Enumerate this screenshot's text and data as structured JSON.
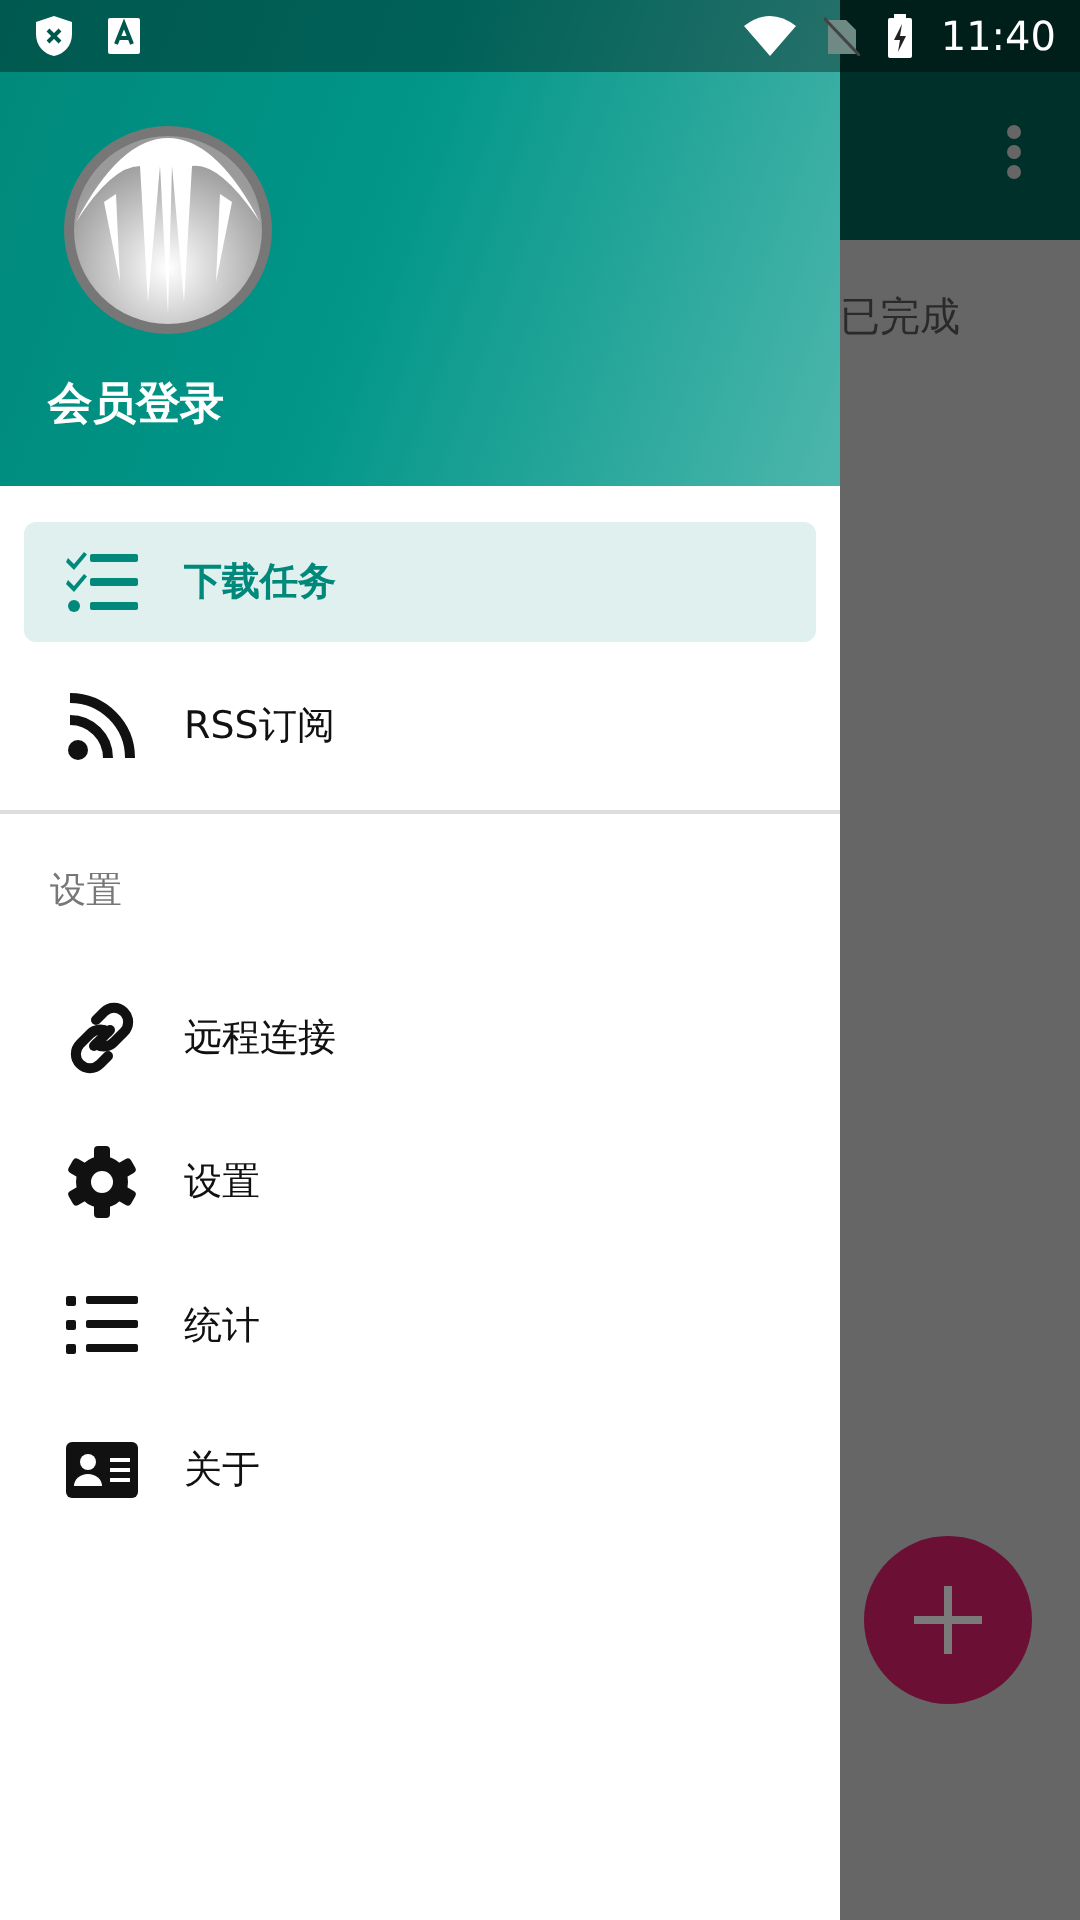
{
  "status_bar": {
    "time": "11:40"
  },
  "background_screen": {
    "tab_label": "已完成"
  },
  "drawer": {
    "header": {
      "title": "会员登录"
    },
    "items": [
      {
        "label": "下载任务",
        "selected": true
      },
      {
        "label": "RSS订阅",
        "selected": false
      }
    ],
    "section": {
      "title": "设置",
      "items": [
        {
          "label": "远程连接",
          "selected": false
        },
        {
          "label": "设置",
          "selected": false
        },
        {
          "label": "统计",
          "selected": false
        },
        {
          "label": "关于",
          "selected": false
        }
      ]
    }
  }
}
